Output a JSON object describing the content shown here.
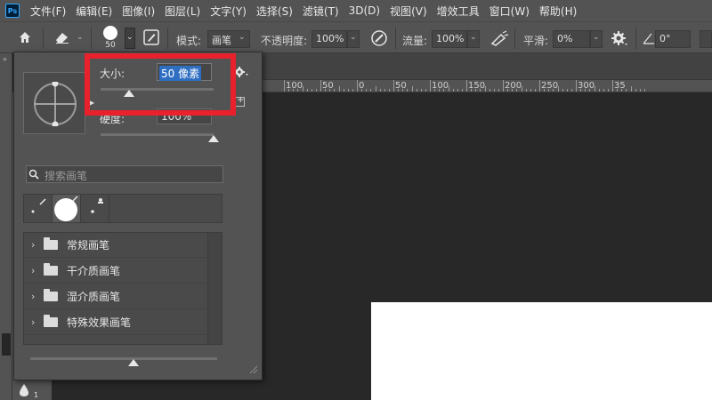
{
  "menubar": {
    "logo_text": "Ps",
    "items": [
      "文件(F)",
      "编辑(E)",
      "图像(I)",
      "图层(L)",
      "文字(Y)",
      "选择(S)",
      "滤镜(T)",
      "3D(D)",
      "视图(V)",
      "增效工具",
      "窗口(W)",
      "帮助(H)"
    ]
  },
  "options": {
    "brush_size": "50",
    "mode_label": "模式:",
    "mode_value": "画笔",
    "opacity_label": "不透明度:",
    "opacity_value": "100%",
    "flow_label": "流量:",
    "flow_value": "100%",
    "smoothing_label": "平滑:",
    "smoothing_value": "0%",
    "angle_value": "0°"
  },
  "ruler": {
    "labels": [
      "100",
      "50",
      "0",
      "50",
      "100",
      "150",
      "200",
      "250",
      "300",
      "35"
    ]
  },
  "brush_panel": {
    "size_label": "大小:",
    "size_value": "50 像素",
    "size_level": 0.25,
    "hardness_label": "硬度:",
    "hardness_value": "100%",
    "hardness_level": 1.0,
    "search_placeholder": "搜索画笔",
    "recent_sizes": [
      "",
      "",
      ""
    ],
    "folders": [
      "常规画笔",
      "干介质画笔",
      "湿介质画笔",
      "特殊效果画笔"
    ],
    "preview_level": 0.55
  },
  "left_tools": {
    "badge": "1"
  },
  "colors": {
    "highlight": "#e8212c",
    "panel": "#535353",
    "canvas": "#282828",
    "document": "#ffffff"
  }
}
